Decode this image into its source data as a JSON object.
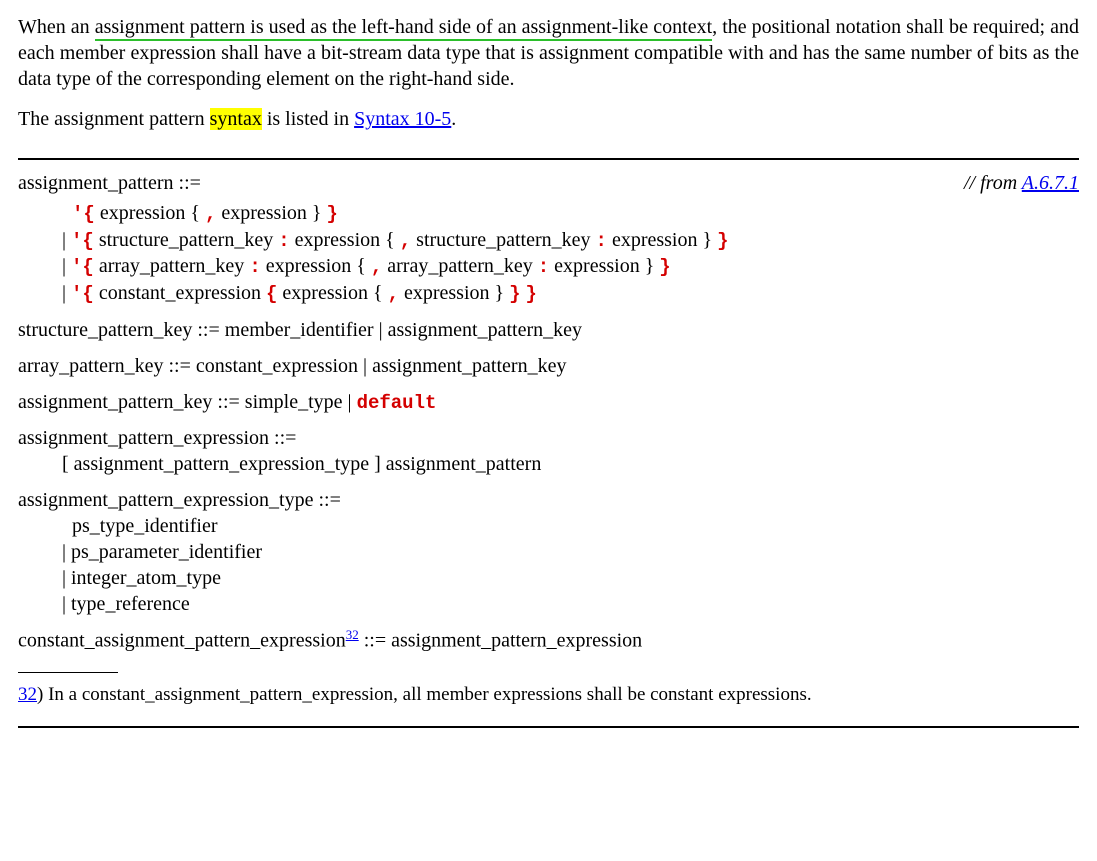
{
  "para1": {
    "u1": "assignment pattern is used as the left-hand side of an assignment-like context",
    "pre": "When an ",
    "post": ", the positional notation shall be required; and each member expression shall have a bit-stream data type that is assignment compatible with and has the same number of bits as the data type of the corresponding element on the right-hand side."
  },
  "para2": {
    "pre": "The assignment pattern ",
    "hl": "syntax",
    "mid": " is listed in ",
    "link": "Syntax 10-5",
    "post": "."
  },
  "from": {
    "label": "// from ",
    "ref": "A.6.7.1"
  },
  "r1": {
    "head": "assignment_pattern ::=",
    "a_open": "'{",
    "a_1": " expression { ",
    "a_comma": ",",
    "a_2": " expression } ",
    "a_close": "}",
    "b_open": "'{",
    "b_1": " structure_pattern_key ",
    "b_colon1": ":",
    "b_2": " expression { ",
    "b_comma": ",",
    "b_3": " structure_pattern_key ",
    "b_colon2": ":",
    "b_4": " expression } ",
    "b_close": "}",
    "c_open": "'{",
    "c_1": " array_pattern_key ",
    "c_colon1": ":",
    "c_2": " expression { ",
    "c_comma": ",",
    "c_3": " array_pattern_key ",
    "c_colon2": ":",
    "c_4": " expression } ",
    "c_close": "}",
    "d_open": "'{",
    "d_1": " constant_expression ",
    "d_open2": "{",
    "d_2": " expression { ",
    "d_comma": ",",
    "d_3": " expression } ",
    "d_close2": "}",
    "d_space": " ",
    "d_close": "}",
    "pipe": "| "
  },
  "r2": "structure_pattern_key ::= member_identifier | assignment_pattern_key",
  "r3": "array_pattern_key ::= constant_expression | assignment_pattern_key",
  "r4": {
    "pre": "assignment_pattern_key ::= simple_type | ",
    "kw": "default"
  },
  "r5": {
    "head": "assignment_pattern_expression ::=",
    "body": "[ assignment_pattern_expression_type ] assignment_pattern"
  },
  "r6": {
    "head": "assignment_pattern_expression_type ::=",
    "a": "ps_type_identifier",
    "b": "| ps_parameter_identifier",
    "c": "| integer_atom_type",
    "d": "| type_reference"
  },
  "r7": {
    "pre": "constant_assignment_pattern_expression",
    "sup": "32",
    "post": " ::= assignment_pattern_expression"
  },
  "footnote": {
    "num": "32",
    "sep": ")   ",
    "text": "In a constant_assignment_pattern_expression, all member expressions shall be constant expressions."
  }
}
